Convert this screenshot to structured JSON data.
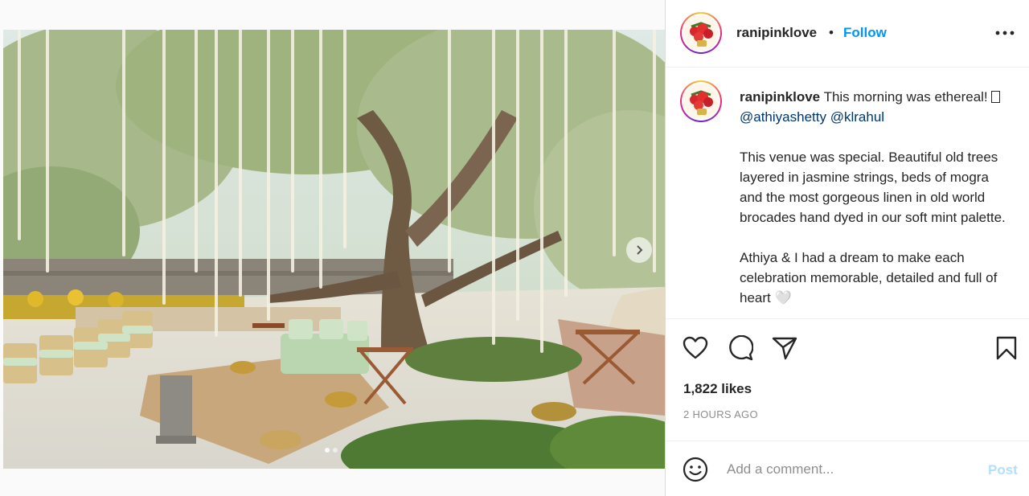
{
  "post": {
    "username": "ranipinklove",
    "separator": "•",
    "follow_label": "Follow",
    "more_icon": "more-options-icon"
  },
  "caption": {
    "username": "ranipinklove",
    "line1_text": "This morning was ethereal! ",
    "emoji_box": "",
    "mention1": "@athiyashetty",
    "mention2": "@klrahul",
    "para2": "This venue was special. Beautiful old trees layered in jasmine strings, beds of mogra and the most gorgeous linen in old world brocades hand dyed in our soft mint palette.",
    "para3": "Athiya & I had a dream to make each celebration memorable, detailed and full of heart 🤍"
  },
  "actions": {
    "like_icon": "heart-icon",
    "comment_icon": "comment-icon",
    "share_icon": "share-icon",
    "save_icon": "bookmark-icon",
    "likes": "1,822 likes",
    "timestamp": "2 HOURS AGO"
  },
  "comment": {
    "placeholder": "Add a comment...",
    "post_label": "Post",
    "emoji_icon": "smiley-icon"
  },
  "carousel": {
    "next_icon": "chevron-right-icon",
    "slide_count": 2,
    "active_slide": 1
  },
  "colors": {
    "accent": "#0095f6",
    "post_disabled": "#b2dffc",
    "mention": "#00376b"
  }
}
